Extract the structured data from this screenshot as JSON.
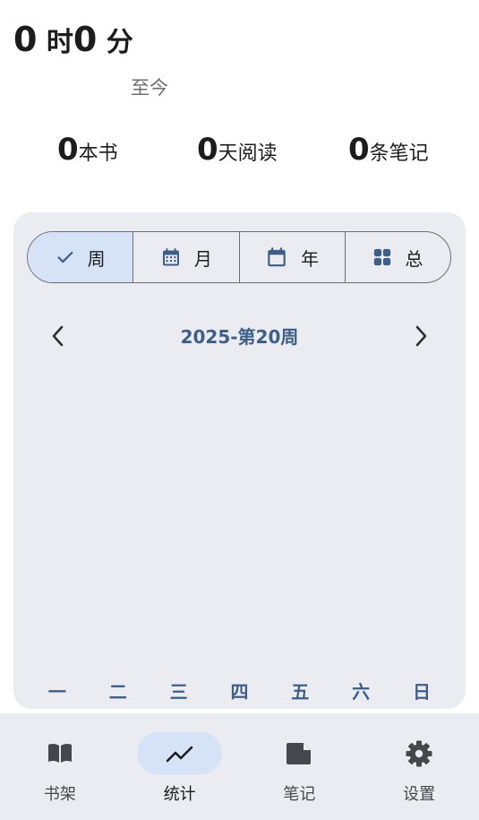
{
  "summary": {
    "hours": "0",
    "hours_unit": " 时",
    "minutes": "0",
    "minutes_unit": " 分",
    "since_label": "至今"
  },
  "stats": [
    {
      "value": "0",
      "label": "本书"
    },
    {
      "value": "0",
      "label": "天阅读"
    },
    {
      "value": "0",
      "label": "条笔记"
    }
  ],
  "segments": [
    {
      "label": "周",
      "icon": "check-icon",
      "selected": true
    },
    {
      "label": "月",
      "icon": "calendar-month-icon",
      "selected": false
    },
    {
      "label": "年",
      "icon": "calendar-icon",
      "selected": false
    },
    {
      "label": "总",
      "icon": "grid-icon",
      "selected": false
    }
  ],
  "period": {
    "label": "2025-第20周",
    "prev_icon": "chevron-left-icon",
    "next_icon": "chevron-right-icon"
  },
  "weekdays": [
    "一",
    "二",
    "三",
    "四",
    "五",
    "六",
    "日"
  ],
  "nav": [
    {
      "label": "书架",
      "icon": "book-open-icon",
      "active": false
    },
    {
      "label": "统计",
      "icon": "trending-up-icon",
      "active": true
    },
    {
      "label": "笔记",
      "icon": "note-icon",
      "active": false
    },
    {
      "label": "设置",
      "icon": "gear-icon",
      "active": false
    }
  ],
  "colors": {
    "accent": "#3e5f85",
    "selected_bg": "#d6e3f7",
    "card_bg": "#ebecf2",
    "text": "#1c1c1f"
  }
}
